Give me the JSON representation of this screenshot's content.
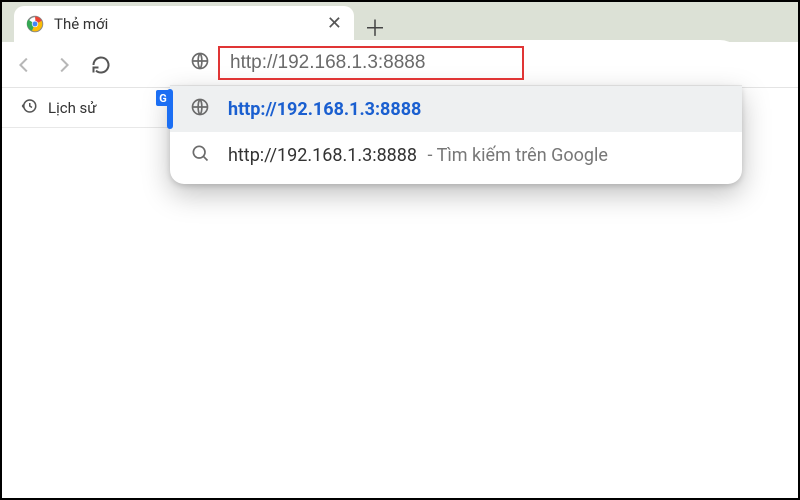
{
  "tab": {
    "title": "Thẻ mới"
  },
  "bookmark": {
    "history_label": "Lịch sử"
  },
  "omnibox": {
    "value": "http://192.168.1.3:8888",
    "suggestions": [
      {
        "text": "http://192.168.1.3:8888",
        "extra": ""
      },
      {
        "text": "http://192.168.1.3:8888",
        "extra": " - Tìm kiếm trên Google"
      }
    ]
  }
}
